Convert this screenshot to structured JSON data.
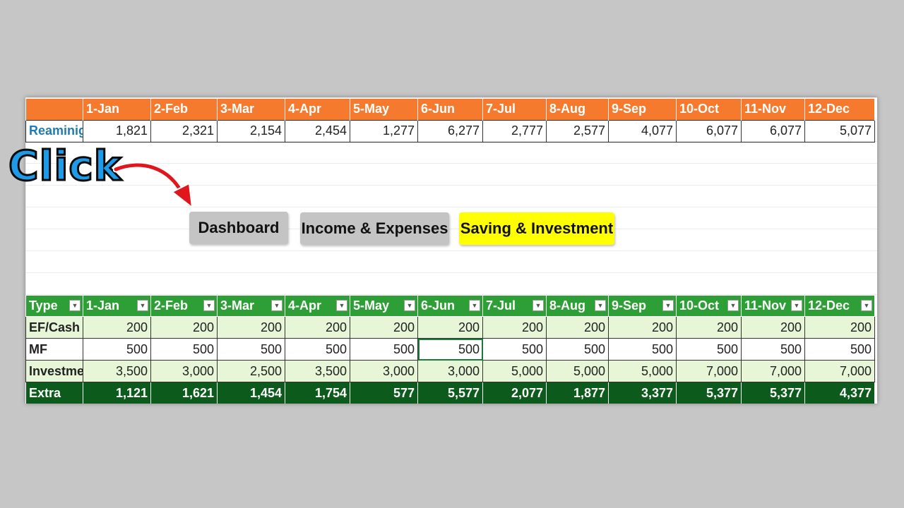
{
  "months": [
    "1-Jan",
    "2-Feb",
    "3-Mar",
    "4-Apr",
    "5-May",
    "6-Jun",
    "7-Jul",
    "8-Aug",
    "9-Sep",
    "10-Oct",
    "11-Nov",
    "12-Dec"
  ],
  "remaining": {
    "label": "Reaminig",
    "values": [
      "1,821",
      "2,321",
      "2,154",
      "2,454",
      "1,277",
      "6,277",
      "2,777",
      "2,577",
      "4,077",
      "6,077",
      "6,077",
      "5,077"
    ]
  },
  "annotation": {
    "text": "Click"
  },
  "buttons": {
    "dashboard": "Dashboard",
    "income": "Income & Expenses",
    "saving": "Saving & Investment"
  },
  "savings_table": {
    "type_header": "Type",
    "rows": [
      {
        "label": "EF/Cash",
        "values": [
          "200",
          "200",
          "200",
          "200",
          "200",
          "200",
          "200",
          "200",
          "200",
          "200",
          "200",
          "200"
        ]
      },
      {
        "label": "MF",
        "values": [
          "500",
          "500",
          "500",
          "500",
          "500",
          "500",
          "500",
          "500",
          "500",
          "500",
          "500",
          "500"
        ]
      },
      {
        "label": "Investment",
        "values": [
          "3,500",
          "3,000",
          "2,500",
          "3,500",
          "3,000",
          "3,000",
          "5,000",
          "5,000",
          "5,000",
          "7,000",
          "7,000",
          "7,000"
        ]
      },
      {
        "label": "Extra",
        "values": [
          "1,121",
          "1,621",
          "1,454",
          "1,754",
          "577",
          "5,577",
          "2,077",
          "1,877",
          "3,377",
          "5,377",
          "5,377",
          "4,377"
        ]
      }
    ]
  },
  "colors": {
    "top_header": "#f57a2e",
    "bottom_header": "#2e9e37",
    "extra_row": "#0d5b1c",
    "saving_button": "#ffff00",
    "gray_button": "#c4c4c4",
    "click_text": "#1e9be8",
    "arrow": "#e0161c"
  }
}
